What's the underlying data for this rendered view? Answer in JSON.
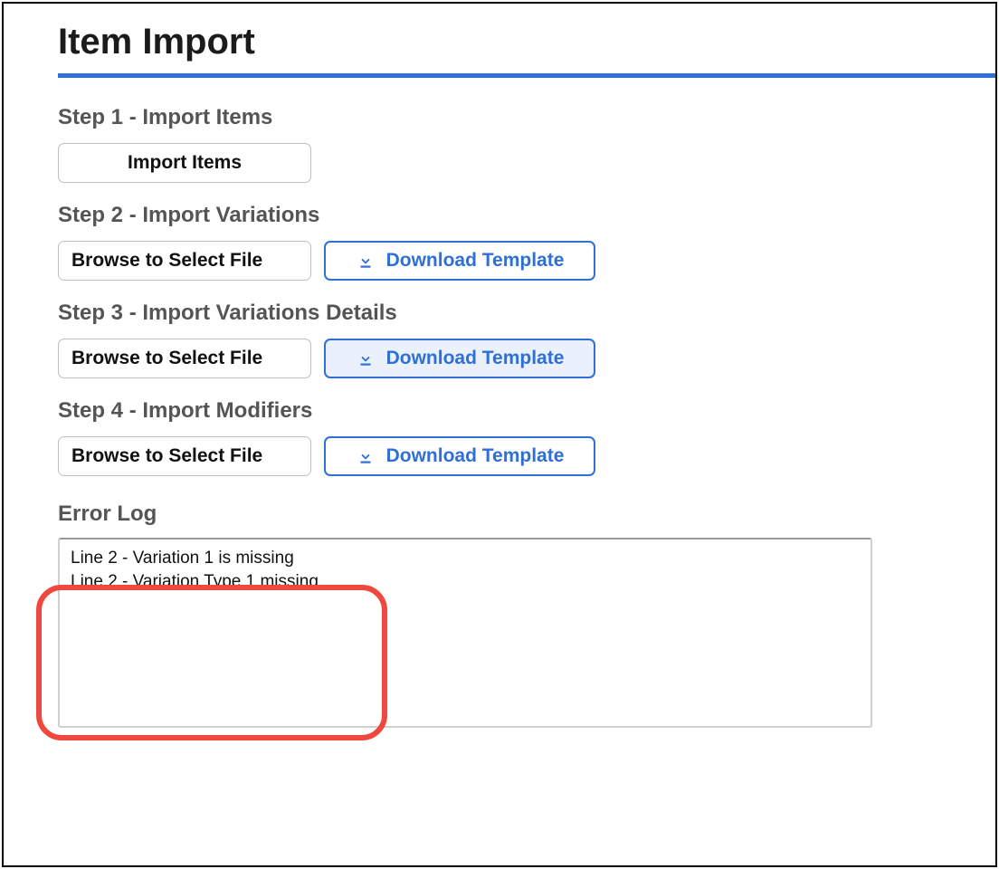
{
  "page": {
    "title": "Item Import"
  },
  "steps": {
    "step1": {
      "heading": "Step 1 - Import Items",
      "button": "Import Items"
    },
    "step2": {
      "heading": "Step 2 - Import Variations",
      "browse": "Browse to Select File",
      "download": "Download Template"
    },
    "step3": {
      "heading": "Step 3 - Import Variations Details",
      "browse": "Browse to Select File",
      "download": "Download Template"
    },
    "step4": {
      "heading": "Step 4 - Import Modifiers",
      "browse": "Browse to Select File",
      "download": "Download Template"
    }
  },
  "errorLog": {
    "heading": "Error Log",
    "lines": [
      "Line 2 - Variation 1  is missing",
      "Line 2 - Variation Type 1 missing."
    ]
  },
  "icons": {
    "download": "download-icon"
  },
  "colors": {
    "accent": "#2f6fd8",
    "highlight": "#ef483e"
  }
}
